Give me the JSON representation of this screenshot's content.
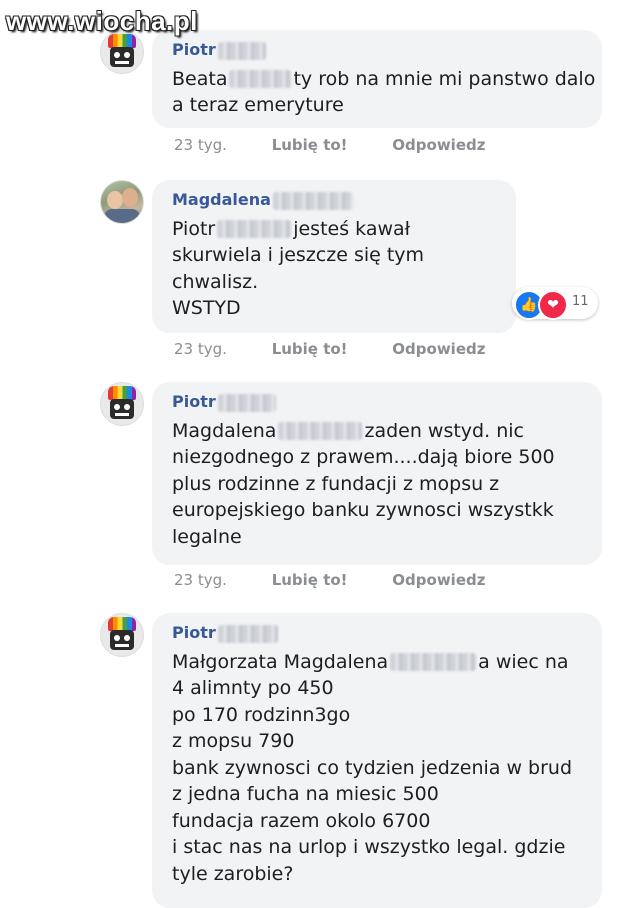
{
  "watermark": "www.wiocha.pl",
  "colors": {
    "bubble": "#f2f3f5",
    "author": "#385898",
    "meta": "#8a8d91",
    "like": "#1877f2",
    "love": "#f0284a"
  },
  "comments": [
    {
      "author": "Piotr",
      "avatar": "rainbow-hat-avatar",
      "lines": [
        "Beata",
        "ty rob na mnie mi panstwo dalo",
        "a teraz emeryture"
      ],
      "time": "23 tyg.",
      "like": "Lubię to!",
      "reply": "Odpowiedz"
    },
    {
      "author": "Magdalena",
      "avatar": "photo-avatar",
      "lines": [
        "Piotr",
        "jesteś kawał",
        "skurwiela i jeszcze się tym",
        "chwalisz.",
        "WSTYD"
      ],
      "time": "23 tyg.",
      "like": "Lubię to!",
      "reply": "Odpowiedz",
      "reactions": {
        "icons": [
          "like-icon",
          "love-icon"
        ],
        "count": "11"
      }
    },
    {
      "author": "Piotr",
      "avatar": "rainbow-hat-avatar",
      "lines": [
        "Magdalena",
        "zaden wstyd. nic",
        "niezgodnego z prawem....dają biore 500",
        "plus rodzinne z fundacji z mopsu z",
        "europejskiego banku zywnosci wszystkk",
        "legalne"
      ],
      "time": "23 tyg.",
      "like": "Lubię to!",
      "reply": "Odpowiedz"
    },
    {
      "author": "Piotr",
      "avatar": "rainbow-hat-avatar",
      "lines": [
        "Małgorzata Magdalena",
        "a wiec na",
        "4 alimnty po 450",
        "po 170 rodzinn3go",
        "z mopsu 790",
        "bank zywnosci co tydzien jedzenia w brud",
        "z jedna fucha na miesic 500",
        "fundacja razem okolo 6700",
        "i stac nas na urlop i wszystko legal. gdzie",
        "tyle zarobie?"
      ]
    }
  ]
}
